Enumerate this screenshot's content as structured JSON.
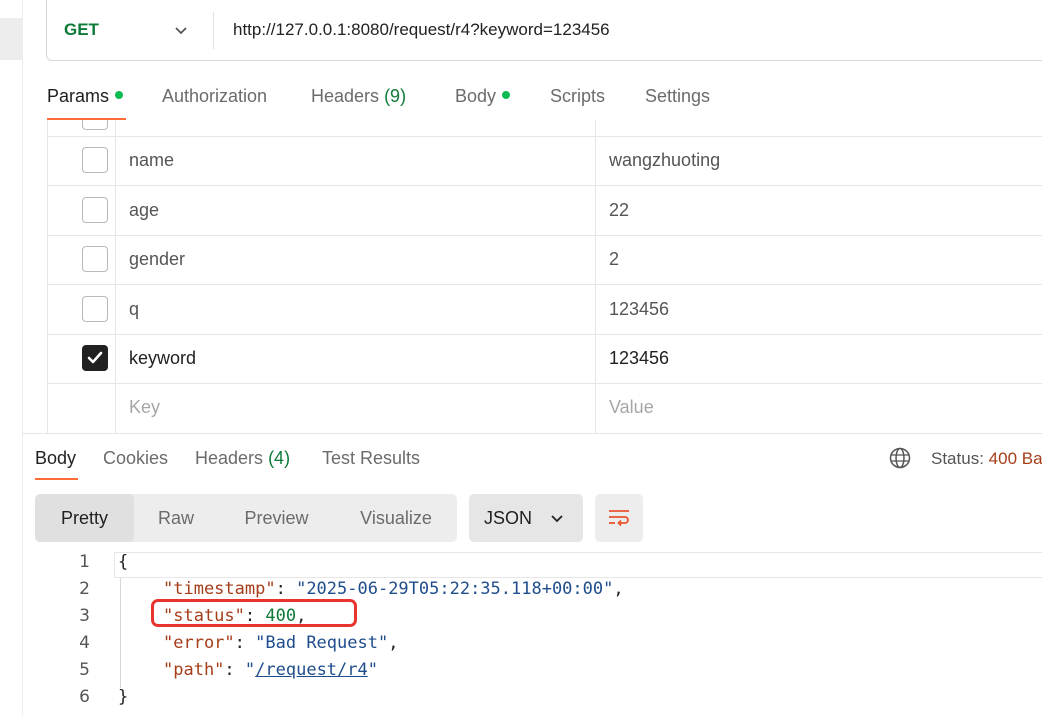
{
  "request": {
    "method": "GET",
    "url": "http://127.0.0.1:8080/request/r4?keyword=123456"
  },
  "request_tabs": [
    {
      "label": "Params",
      "dot": true,
      "active": true
    },
    {
      "label": "Authorization"
    },
    {
      "label": "Headers",
      "count": "(9)"
    },
    {
      "label": "Body",
      "dot": true
    },
    {
      "label": "Scripts"
    },
    {
      "label": "Settings"
    }
  ],
  "params": {
    "rows": [
      {
        "key": "name",
        "value": "wangzhuoting",
        "checked": false
      },
      {
        "key": "age",
        "value": "22",
        "checked": false
      },
      {
        "key": "gender",
        "value": "2",
        "checked": false
      },
      {
        "key": "q",
        "value": "123456",
        "checked": false
      },
      {
        "key": "keyword",
        "value": "123456",
        "checked": true
      }
    ],
    "key_placeholder": "Key",
    "value_placeholder": "Value"
  },
  "response_tabs": [
    {
      "label": "Body",
      "active": true
    },
    {
      "label": "Cookies"
    },
    {
      "label": "Headers",
      "count": "(4)"
    },
    {
      "label": "Test Results"
    }
  ],
  "status": {
    "label": "Status:",
    "code": "400 Ba"
  },
  "view_modes": [
    "Pretty",
    "Raw",
    "Preview",
    "Visualize"
  ],
  "active_view": "Pretty",
  "format": "JSON",
  "code": {
    "line_numbers": [
      "1",
      "2",
      "3",
      "4",
      "5",
      "6"
    ],
    "open_brace": "{",
    "close_brace": "}",
    "timestamp_key": "\"timestamp\"",
    "timestamp_value": "\"2025-06-29T05:22:35.118+00:00\"",
    "status_key": "\"status\"",
    "status_value": "400",
    "error_key": "\"error\"",
    "error_value": "\"Bad Request\"",
    "path_key": "\"path\"",
    "path_value": "/request/r4",
    "colon": ": ",
    "comma": ",",
    "quote": "\""
  },
  "colors": {
    "accent": "#ff6c37",
    "method": "#0d7a38",
    "highlight_box": "#e8332e"
  }
}
